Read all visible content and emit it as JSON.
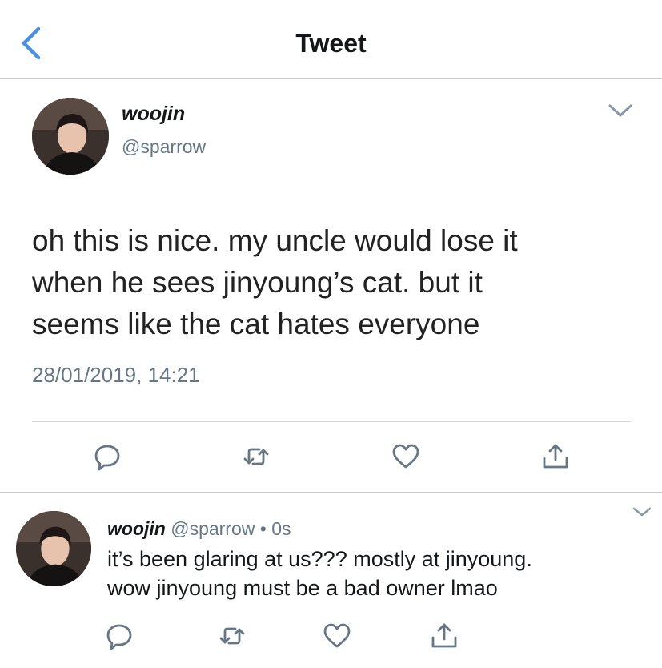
{
  "header": {
    "title": "Tweet",
    "back_icon": "chevron-left-icon",
    "accent": "#4a90e2"
  },
  "main_tweet": {
    "name": "woojin",
    "handle": "@sparrow",
    "text_lines": [
      "oh this is nice. my uncle would lose it",
      "when he sees jinyoung’s cat. but it",
      "seems like the cat hates everyone"
    ],
    "timestamp": "28/01/2019, 14:21",
    "actions": [
      "reply-icon",
      "retweet-icon",
      "like-icon",
      "share-icon"
    ]
  },
  "reply_tweet": {
    "name": "woojin",
    "handle": "@sparrow",
    "separator": " • ",
    "time": "0s",
    "text_lines": [
      "it’s been glaring at us??? mostly at jinyoung.",
      "wow jinyoung must be a bad owner lmao"
    ],
    "actions": [
      "reply-icon",
      "retweet-icon",
      "like-icon",
      "share-icon"
    ]
  },
  "colors": {
    "text": "#14171a",
    "secondary": "#657786",
    "icon": "#657786",
    "divider": "#c8ccd0"
  }
}
